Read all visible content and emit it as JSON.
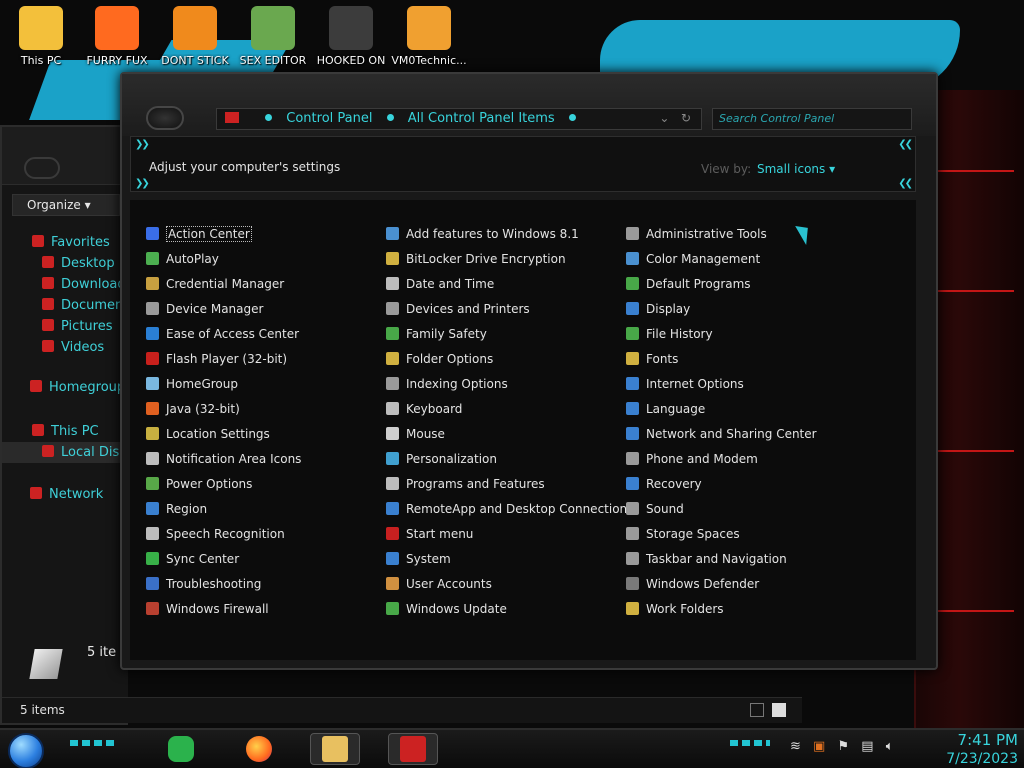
{
  "desktop": {
    "icons": [
      {
        "label": "This PC",
        "icon": "this-pc-icon",
        "color": "#f3c03b"
      },
      {
        "label": "FURRY FUX",
        "icon": "firefox-icon",
        "color": "#ff6a1f"
      },
      {
        "label": "DONT STICK",
        "icon": "vlc-cone-icon",
        "color": "#f08a1c"
      },
      {
        "label": "SEX EDITOR",
        "icon": "hxd-editor-icon",
        "color": "#6aa84f"
      },
      {
        "label": "HOOKED ON",
        "icon": "hooked-on-icon",
        "color": "#3c3c3c"
      },
      {
        "label": "VM0Technic...",
        "icon": "technician-icon",
        "color": "#f0a030"
      }
    ]
  },
  "back_window": {
    "organize_label": "Organize",
    "nav": [
      {
        "label": "Favorites"
      },
      {
        "label": "Desktop"
      },
      {
        "label": "Downloads"
      },
      {
        "label": "Documents"
      },
      {
        "label": "Pictures"
      },
      {
        "label": "Videos"
      },
      {
        "label": "Homegroup"
      },
      {
        "label": "This PC"
      },
      {
        "label": "Local Disk"
      },
      {
        "label": "Network"
      }
    ],
    "items_count": "5 items",
    "items_count_short": "5 ite"
  },
  "control_panel": {
    "breadcrumb": [
      "Control Panel",
      "All Control Panel Items"
    ],
    "search_placeholder": "Search Control Panel",
    "title": "Adjust your computer's settings",
    "view_by_label": "View by:",
    "view_mode": "Small icons",
    "columns": [
      [
        {
          "label": "Action Center",
          "color": "#3a6ee8"
        },
        {
          "label": "AutoPlay",
          "color": "#4caf50"
        },
        {
          "label": "Credential Manager",
          "color": "#c8a040"
        },
        {
          "label": "Device Manager",
          "color": "#9a9a9a"
        },
        {
          "label": "Ease of Access Center",
          "color": "#2a7fd4"
        },
        {
          "label": "Flash Player (32-bit)",
          "color": "#c8201c"
        },
        {
          "label": "HomeGroup",
          "color": "#7ab8e0"
        },
        {
          "label": "Java (32-bit)",
          "color": "#e06020"
        },
        {
          "label": "Location Settings",
          "color": "#c8b040"
        },
        {
          "label": "Notification Area Icons",
          "color": "#bdbdbd"
        },
        {
          "label": "Power Options",
          "color": "#58a848"
        },
        {
          "label": "Region",
          "color": "#3a80d0"
        },
        {
          "label": "Speech Recognition",
          "color": "#bdbdbd"
        },
        {
          "label": "Sync Center",
          "color": "#38b048"
        },
        {
          "label": "Troubleshooting",
          "color": "#3a70c8"
        },
        {
          "label": "Windows Firewall",
          "color": "#b84030"
        }
      ],
      [
        {
          "label": "Add features to Windows 8.1",
          "color": "#4a90d0"
        },
        {
          "label": "BitLocker Drive Encryption",
          "color": "#d0b040"
        },
        {
          "label": "Date and Time",
          "color": "#bdbdbd"
        },
        {
          "label": "Devices and Printers",
          "color": "#9a9a9a"
        },
        {
          "label": "Family Safety",
          "color": "#48a848"
        },
        {
          "label": "Folder Options",
          "color": "#d0b040"
        },
        {
          "label": "Indexing Options",
          "color": "#9a9a9a"
        },
        {
          "label": "Keyboard",
          "color": "#bdbdbd"
        },
        {
          "label": "Mouse",
          "color": "#cfcfcf"
        },
        {
          "label": "Personalization",
          "color": "#40a0d0"
        },
        {
          "label": "Programs and Features",
          "color": "#bdbdbd"
        },
        {
          "label": "RemoteApp and Desktop Connections",
          "color": "#3a80d0"
        },
        {
          "label": "Start menu",
          "color": "#c82020"
        },
        {
          "label": "System",
          "color": "#3a80d0"
        },
        {
          "label": "User Accounts",
          "color": "#d09040"
        },
        {
          "label": "Windows Update",
          "color": "#48a848"
        }
      ],
      [
        {
          "label": "Administrative Tools",
          "color": "#9a9a9a"
        },
        {
          "label": "Color Management",
          "color": "#4a90d0"
        },
        {
          "label": "Default Programs",
          "color": "#48a848"
        },
        {
          "label": "Display",
          "color": "#3a80d0"
        },
        {
          "label": "File History",
          "color": "#48a848"
        },
        {
          "label": "Fonts",
          "color": "#d0b040"
        },
        {
          "label": "Internet Options",
          "color": "#3a80d0"
        },
        {
          "label": "Language",
          "color": "#3a80d0"
        },
        {
          "label": "Network and Sharing Center",
          "color": "#3a80d0"
        },
        {
          "label": "Phone and Modem",
          "color": "#9a9a9a"
        },
        {
          "label": "Recovery",
          "color": "#3a80d0"
        },
        {
          "label": "Sound",
          "color": "#9a9a9a"
        },
        {
          "label": "Storage Spaces",
          "color": "#9a9a9a"
        },
        {
          "label": "Taskbar and Navigation",
          "color": "#9a9a9a"
        },
        {
          "label": "Windows Defender",
          "color": "#7a7a7a"
        },
        {
          "label": "Work Folders",
          "color": "#d0b040"
        }
      ]
    ]
  },
  "taskbar": {
    "time": "7:41 PM",
    "date": "7/23/2023",
    "accent": "#22c4d2"
  }
}
